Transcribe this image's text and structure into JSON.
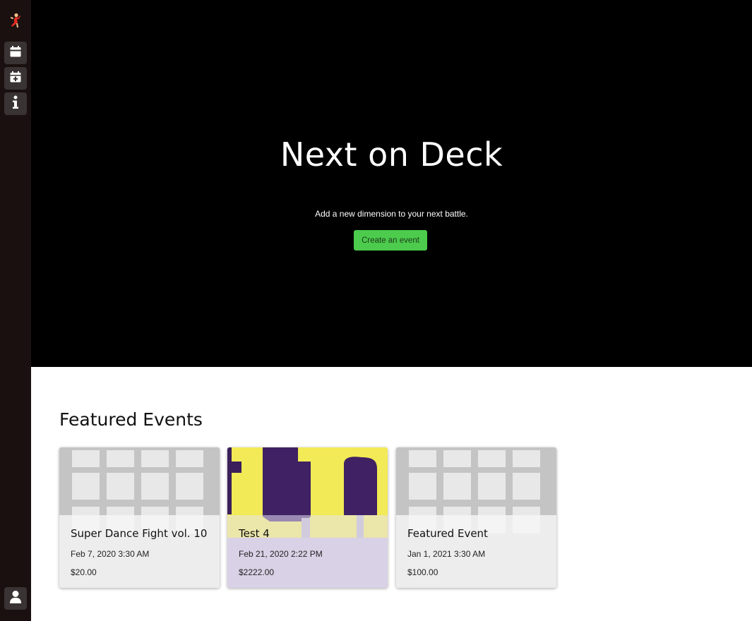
{
  "sidebar": {
    "logo_icon": "dancer-icon",
    "items": [
      {
        "icon": "calendar-icon",
        "name": "events"
      },
      {
        "icon": "calendar-plus-icon",
        "name": "create-event"
      },
      {
        "icon": "info-icon",
        "name": "about"
      }
    ],
    "profile_icon": "user-icon"
  },
  "hero": {
    "title": "Next on Deck",
    "subtitle": "Add a new dimension to your next battle.",
    "cta_label": "Create an event"
  },
  "featured": {
    "heading": "Featured Events",
    "cards": [
      {
        "title": "Super Dance Fight vol. 10",
        "date": "Feb 7, 2020 3:30 AM",
        "price": "$20.00",
        "image": "placeholder-grid"
      },
      {
        "title": "Test 4",
        "date": "Feb 21, 2020 2:22 PM",
        "price": "$2222.00",
        "image": "yellow-purple-artwork"
      },
      {
        "title": "Featured Event",
        "date": "Jan 1, 2021 3:30 AM",
        "price": "$100.00",
        "image": "placeholder-grid"
      }
    ]
  },
  "colors": {
    "sidebar_bg": "#1a1010",
    "hero_bg": "#000000",
    "accent_green": "#4ccb4c",
    "sidebar_button_bg": "#3a3333"
  }
}
